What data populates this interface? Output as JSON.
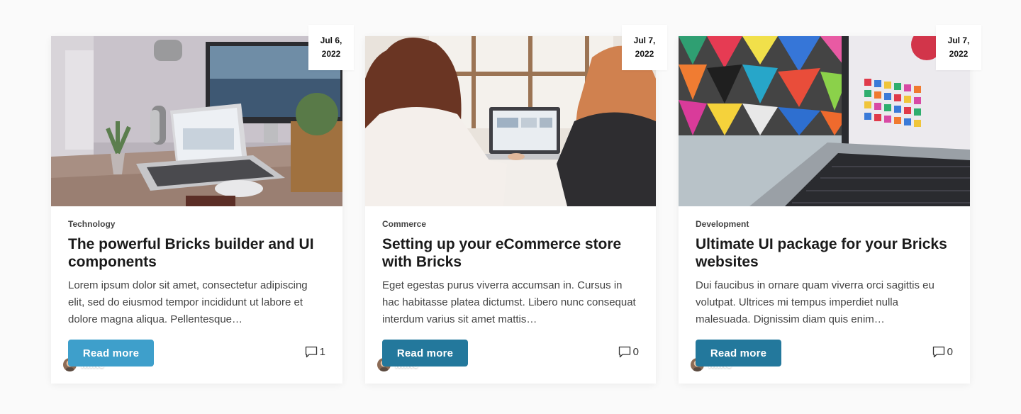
{
  "posts": [
    {
      "date_line1": "Jul 6,",
      "date_line2": "2022",
      "author": "Mike",
      "category": "Technology",
      "title": "The powerful Bricks builder and UI components",
      "excerpt": "Lorem ipsum dolor sit amet, consectetur adipiscing elit, sed do eiusmod tempor incididunt ut labore et dolore magna aliqua. Pellentesque…",
      "button_label": "Read more",
      "comment_count": "1",
      "button_color": "#3e9fcb",
      "image_icon": "desk-workspace-photo"
    },
    {
      "date_line1": "Jul 7,",
      "date_line2": "2022",
      "author": "Mike",
      "category": "Commerce",
      "title": "Setting up your eCommerce store with Bricks",
      "excerpt": "Eget egestas purus viverra accumsan in. Cursus in hac habitasse platea dictumst. Libero nunc consequat interdum varius sit amet mattis…",
      "button_label": "Read more",
      "comment_count": "0",
      "button_color": "#23789c",
      "image_icon": "two-women-laptop-photo"
    },
    {
      "date_line1": "Jul 7,",
      "date_line2": "2022",
      "author": "Mike",
      "category": "Development",
      "title": "Ultimate UI package for your Bricks websites",
      "excerpt": "Dui faucibus in ornare quam viverra orci sagittis eu volutpat. Ultrices mi tempus imperdiet nulla malesuada. Dignissim diam quis enim…",
      "button_label": "Read more",
      "comment_count": "0",
      "button_color": "#23789c",
      "image_icon": "laptop-colorful-art-photo"
    }
  ]
}
